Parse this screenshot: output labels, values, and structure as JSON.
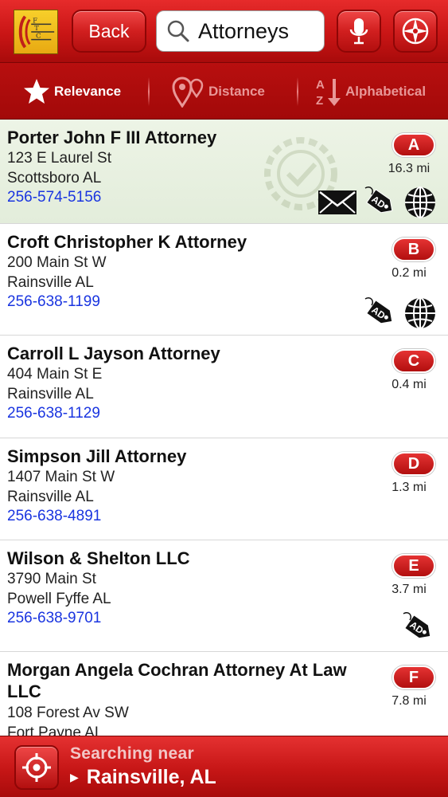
{
  "header": {
    "logo_icon": "ftc-logo-icon",
    "back_label": "Back",
    "search_query": "Attorneys",
    "mic_icon": "microphone-icon",
    "nav_icon": "compass-icon"
  },
  "sort": {
    "relevance": "Relevance",
    "distance": "Distance",
    "alphabetical": "Alphabetical",
    "active": "relevance"
  },
  "results": [
    {
      "name": "Porter John F III Attorney",
      "address": "123 E Laurel St",
      "city": "Scottsboro AL",
      "phone": "256-574-5156",
      "letter": "A",
      "distance": "16.3 mi",
      "icons": [
        "email-icon",
        "ad-tag-icon",
        "web-globe-icon"
      ],
      "featured": true
    },
    {
      "name": "Croft Christopher K Attorney",
      "address": "200 Main St W",
      "city": "Rainsville AL",
      "phone": "256-638-1199",
      "letter": "B",
      "distance": "0.2 mi",
      "icons": [
        "ad-tag-icon",
        "web-globe-icon"
      ]
    },
    {
      "name": "Carroll L Jayson Attorney",
      "address": "404 Main St E",
      "city": "Rainsville AL",
      "phone": "256-638-1129",
      "letter": "C",
      "distance": "0.4 mi",
      "icons": []
    },
    {
      "name": "Simpson Jill Attorney",
      "address": "1407 Main St W",
      "city": "Rainsville AL",
      "phone": "256-638-4891",
      "letter": "D",
      "distance": "1.3 mi",
      "icons": []
    },
    {
      "name": "Wilson & Shelton LLC",
      "address": "3790 Main St",
      "city": "Powell Fyffe AL",
      "phone": "256-638-9701",
      "letter": "E",
      "distance": "3.7 mi",
      "icons": [
        "ad-tag-icon"
      ]
    },
    {
      "name": "Morgan Angela Cochran Attorney At Law LLC",
      "address": "108 Forest Av SW",
      "city": "Fort Payne AL",
      "phone": "",
      "letter": "F",
      "distance": "7.8 mi",
      "icons": []
    }
  ],
  "footer": {
    "searching_near": "Searching near",
    "location": "Rainsville, AL"
  },
  "colors": {
    "brand_red": "#c91515",
    "phone_blue": "#1a35e0",
    "featured_bg": "#e8f0e0"
  }
}
